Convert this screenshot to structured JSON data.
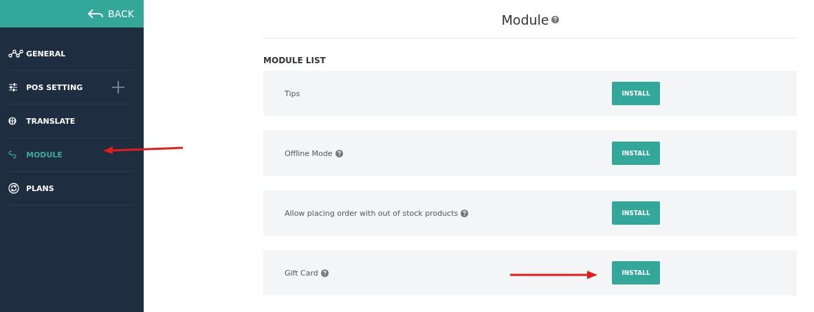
{
  "sidebar": {
    "back": "BACK",
    "items": [
      {
        "label": "GENERAL",
        "kind": "nodes",
        "selected": false,
        "expandable": false
      },
      {
        "label": "POS SETTING",
        "kind": "sliders",
        "selected": false,
        "expandable": true
      },
      {
        "label": "TRANSLATE",
        "kind": "globe",
        "selected": false,
        "expandable": false
      },
      {
        "label": "MODULE",
        "kind": "link",
        "selected": true,
        "expandable": false
      },
      {
        "label": "PLANS",
        "kind": "refresh",
        "selected": false,
        "expandable": false
      }
    ]
  },
  "page": {
    "title": "Module",
    "title_help": true,
    "section": "MODULE LIST",
    "modules": [
      {
        "name": "Tips",
        "help": false,
        "button": "INSTALL"
      },
      {
        "name": "Offline Mode",
        "help": true,
        "button": "INSTALL"
      },
      {
        "name": "Allow placing order with out of stock products",
        "help": true,
        "button": "INSTALL"
      },
      {
        "name": "Gift Card",
        "help": true,
        "button": "INSTALL"
      }
    ]
  }
}
